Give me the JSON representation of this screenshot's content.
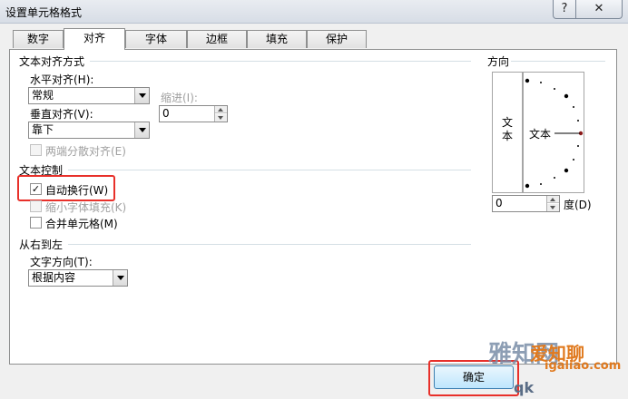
{
  "window": {
    "title": "设置单元格格式",
    "help": "?",
    "close": "✕"
  },
  "tabs": [
    "数字",
    "对齐",
    "字体",
    "边框",
    "填充",
    "保护"
  ],
  "text_alignment": {
    "section": "文本对齐方式",
    "horizontal_label": "水平对齐(H):",
    "horizontal_value": "常规",
    "indent_label": "缩进(I):",
    "indent_value": "0",
    "vertical_label": "垂直对齐(V):",
    "vertical_value": "靠下",
    "justify_distributed": "两端分散对齐(E)"
  },
  "text_control": {
    "section": "文本控制",
    "wrap_text": "自动换行(W)",
    "wrap_checked": true,
    "shrink_to_fit": "缩小字体填充(K)",
    "merge_cells": "合并单元格(M)"
  },
  "rtl": {
    "section": "从右到左",
    "direction_label": "文字方向(T):",
    "direction_value": "根据内容"
  },
  "orientation": {
    "section": "方向",
    "vertical_text": "文本",
    "horizontal_text": "文本",
    "degrees_value": "0",
    "degrees_label": "度(D)"
  },
  "buttons": {
    "ok": "确定"
  },
  "watermark": {
    "logo": "雅知网",
    "brand": "爱知聊",
    "url": "igaliao.com",
    "partial": "qk"
  },
  "colors": {
    "highlight": "#e8302a",
    "tab_border": "#8e8f8f"
  }
}
